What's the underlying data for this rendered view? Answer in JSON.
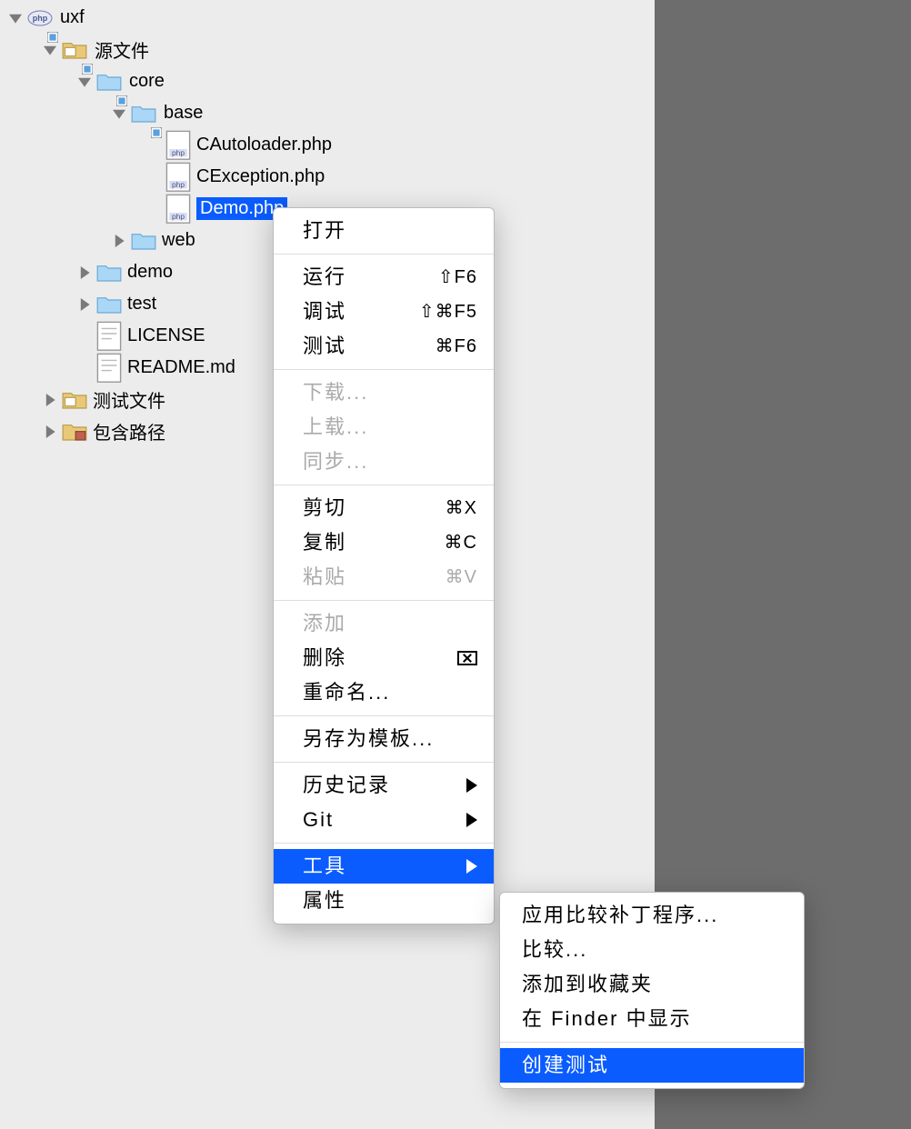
{
  "tree": {
    "root": "uxf",
    "sources": "源文件",
    "core": "core",
    "base": "base",
    "f1": "CAutoloader.php",
    "f2": "CException.php",
    "f3": "Demo.php",
    "web": "web",
    "demo": "demo",
    "test": "test",
    "license": "LICENSE",
    "readme": "README.md",
    "testfiles": "测试文件",
    "incpath": "包含路径"
  },
  "menu1": {
    "open": "打开",
    "run": "运行",
    "run_kb": "⇧F6",
    "debug": "调试",
    "debug_kb": "⇧⌘F5",
    "test_": "测试",
    "test_kb": "⌘F6",
    "download": "下载...",
    "upload": "上载...",
    "sync": "同步...",
    "cut": "剪切",
    "cut_kb": "⌘X",
    "copy": "复制",
    "copy_kb": "⌘C",
    "paste": "粘贴",
    "paste_kb": "⌘V",
    "add": "添加",
    "delete": "删除",
    "rename": "重命名...",
    "saveas_tpl": "另存为模板...",
    "history": "历史记录",
    "git": "Git",
    "tools": "工具",
    "properties": "属性"
  },
  "menu2": {
    "apply_patch": "应用比较补丁程序...",
    "compare": "比较...",
    "add_fav": "添加到收藏夹",
    "reveal_finder": "在 Finder 中显示",
    "create_test": "创建测试"
  }
}
